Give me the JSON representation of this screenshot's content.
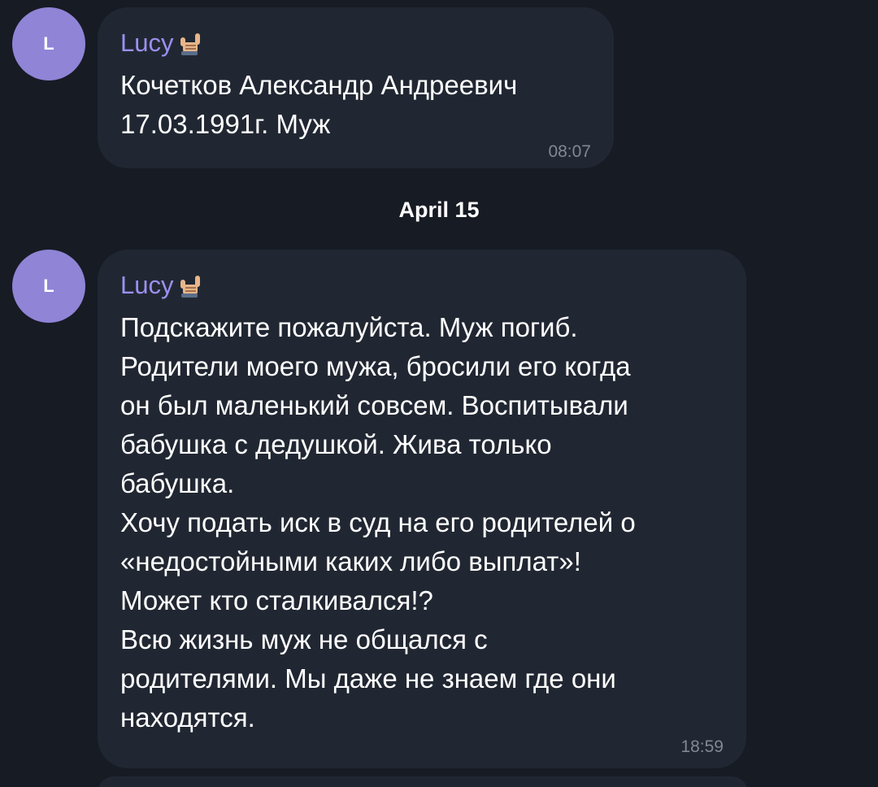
{
  "messages": [
    {
      "avatar_letter": "L",
      "sender": "Lucy",
      "sender_emoji": "call-me-hand-emoji",
      "text": "Кочетков Александр Андреевич\n17.03.1991г. Муж",
      "time": "08:07"
    },
    {
      "avatar_letter": "L",
      "sender": "Lucy",
      "sender_emoji": "call-me-hand-emoji",
      "text": "Подскажите пожалуйста. Муж погиб.\nРодители моего мужа, бросили его когда\nон был маленький совсем. Воспитывали\nбабушка с дедушкой. Жива только\nбабушка.\nХочу подать иск в суд на его родителей о\n«недостойными каких либо выплат»!\nМожет кто сталкивался!?\nВсю жизнь муж не общался с\nродителями. Мы даже не знаем где они\nнаходятся.",
      "time": "18:59"
    }
  ],
  "date_separator": "April 15",
  "colors": {
    "background": "#171b24",
    "bubble": "#212732",
    "avatar": "#8f84d6",
    "sender_name": "#9b8ff0",
    "time": "#7f8894"
  }
}
